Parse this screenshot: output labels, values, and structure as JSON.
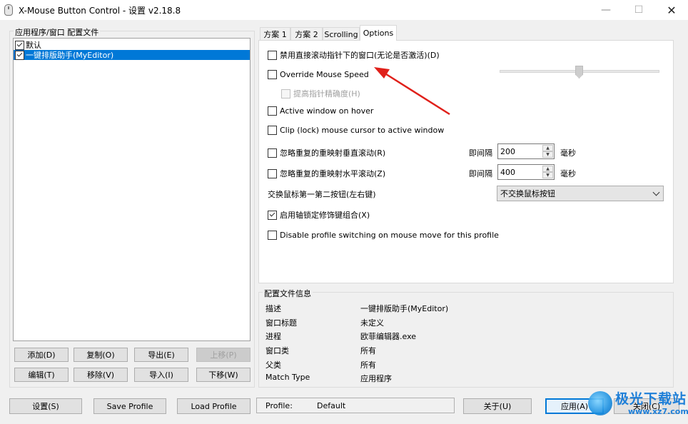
{
  "window": {
    "title": "X-Mouse Button Control - 设置 v2.18.8",
    "min_glyph": "—",
    "max_glyph": "☐",
    "close_glyph": "✕"
  },
  "profiles": {
    "group_label": "应用程序/窗口 配置文件",
    "items": [
      {
        "label": "默认",
        "checked": true,
        "selected": false
      },
      {
        "label": "一键排版助手(MyEditor)",
        "checked": true,
        "selected": true
      }
    ]
  },
  "profile_buttons": {
    "add": "添加(D)",
    "copy": "复制(O)",
    "export": "导出(E)",
    "move_up": "上移(P)",
    "edit": "编辑(T)",
    "remove": "移除(V)",
    "import": "导入(I)",
    "move_down": "下移(W)"
  },
  "tabs": [
    {
      "label": "方案 1"
    },
    {
      "label": "方案 2"
    },
    {
      "label": "Scrolling"
    },
    {
      "label": "Options",
      "active": true
    }
  ],
  "options": {
    "disable_scroll_inactive": "禁用直接滚动指针下的窗口(无论是否激活)(D)",
    "override_mouse_speed": "Override Mouse Speed",
    "enhance_precision": "提高指针精确度(H)",
    "active_window_hover": "Active window on hover",
    "clip_cursor": "Clip (lock) mouse cursor to active window",
    "ignore_vertical": "忽略重复的重映射垂直滚动(R)",
    "ignore_horizontal": "忽略重复的重映射水平滚动(Z)",
    "interval_label": "即间隔",
    "interval_vertical": "200",
    "interval_horizontal": "400",
    "ms_label": "毫秒",
    "swap_buttons_label": "交换鼠标第一第二按钮(左右键)",
    "swap_buttons_value": "不交换鼠标按钮",
    "axis_lock": "启用轴锁定修饰键组合(X)",
    "disable_profile_switching": "Disable profile switching on mouse move for this profile",
    "mouse_speed_level": 0.5
  },
  "profile_info": {
    "group_label": "配置文件信息",
    "rows": [
      {
        "label": "描述",
        "value": "一键排版助手(MyEditor)"
      },
      {
        "label": "窗口标题",
        "value": "未定义"
      },
      {
        "label": "进程",
        "value": "欧菲编辑器.exe"
      },
      {
        "label": "窗口类",
        "value": "所有"
      },
      {
        "label": "父类",
        "value": "所有"
      },
      {
        "label": "Match Type",
        "value": "应用程序"
      }
    ]
  },
  "bottom": {
    "settings": "设置(S)",
    "save_profile": "Save Profile",
    "load_profile": "Load Profile",
    "profile_label": "Profile:",
    "profile_value": "Default",
    "about": "关于(U)",
    "apply": "应用(A)",
    "close": "关闭(C)"
  },
  "watermark": {
    "line1": "极光下载站",
    "line2": "www.xz7.com"
  },
  "colors": {
    "selection": "#0078d7",
    "annotation_arrow": "#e0201a"
  }
}
